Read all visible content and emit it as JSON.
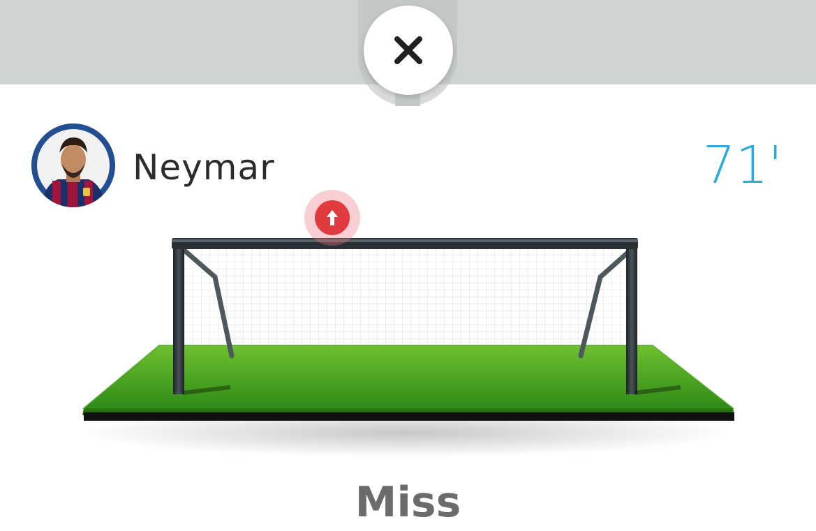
{
  "modal": {
    "close_icon": "close-icon"
  },
  "event": {
    "player_name": "Neymar",
    "minute": "71'",
    "result": "Miss",
    "shot_direction_icon": "arrow-up-icon",
    "minute_color": "#2aa9e6",
    "marker_color": "#e03c40"
  }
}
